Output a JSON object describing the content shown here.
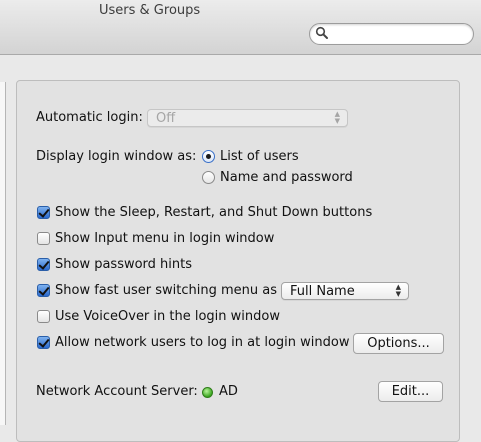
{
  "window": {
    "title": "Users & Groups"
  },
  "search": {
    "value": "",
    "placeholder": "",
    "icon": "search-icon"
  },
  "login_options": {
    "automatic_login": {
      "label": "Automatic login:",
      "value": "Off",
      "enabled": false
    },
    "display_login_window": {
      "label": "Display login window as:",
      "options": [
        {
          "label": "List of users",
          "selected": true
        },
        {
          "label": "Name and password",
          "selected": false
        }
      ]
    },
    "checkboxes": [
      {
        "label": "Show the Sleep, Restart, and Shut Down buttons",
        "checked": true
      },
      {
        "label": "Show Input menu in login window",
        "checked": false
      },
      {
        "label": "Show password hints",
        "checked": true
      },
      {
        "label": "Show fast user switching menu as",
        "checked": true
      },
      {
        "label": "Use VoiceOver in the login window",
        "checked": false
      },
      {
        "label": "Allow network users to log in at login window",
        "checked": true
      }
    ],
    "fast_user_switching_menu": {
      "value": "Full Name"
    },
    "options_button": "Options...",
    "network_account_server": {
      "label": "Network Account Server:",
      "status_color": "#3aa51f",
      "value": "AD",
      "edit_button": "Edit..."
    }
  }
}
